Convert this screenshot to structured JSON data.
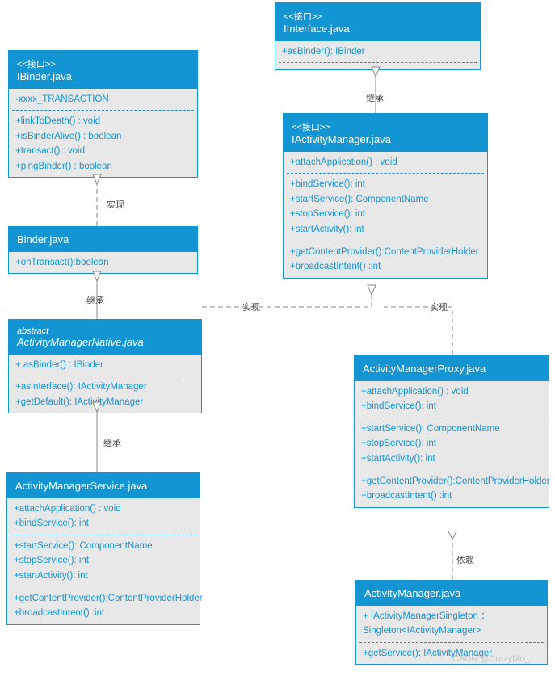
{
  "classes": {
    "ibinder": {
      "stereotype": "<<接口>>",
      "name": "IBinder.java",
      "attrs": "-xxxx_TRANSACTION",
      "methods": "+linkToDeath() : void\n+isBinderAlive() : boolean\n+transact() : void\n+pingBinder() : boolean"
    },
    "iinterface": {
      "stereotype": "<<接口>>",
      "name": "IInterface.java",
      "m1": "+asBinder(): IBinder"
    },
    "binder": {
      "name": "Binder.java",
      "m1": "+onTransact():boolean"
    },
    "iactivitymanager": {
      "stereotype": "<<接口>>",
      "name": "IActivityManager.java",
      "m1": "+attachApplication() : void",
      "m2": "+bindService(): int\n+startService(): ComponentName\n+stopService(): int\n+startActivity(): int",
      "m3": "+getContentProvider():ContentProviderHolder\n+broadcastIntent() :int"
    },
    "amnative": {
      "stereotype": "abstract",
      "name": "ActivityManagerNative.java",
      "m1": "+ asBinder() : IBinder",
      "m2": "+asInterface(): IActivityManager\n+getDefault(): IActivityManager"
    },
    "amproxy": {
      "name": "ActivityManagerProxy.java",
      "m1": "+attachApplication() : void\n+bindService(): int",
      "m2": "+startService(): ComponentName\n+stopService(): int\n+startActivity(): int",
      "m3": "+getContentProvider():ContentProviderHolder\n+broadcastIntent() :int"
    },
    "ams": {
      "name": "ActivityManagerService.java",
      "m1": "+attachApplication() : void\n+bindService(): int",
      "m2": "+startService(): ComponentName\n+stopService(): int\n+startActivity(): int",
      "m3": "+getContentProvider():ContentProviderHolder\n+broadcastIntent() :int"
    },
    "am": {
      "name": "ActivityManager.java",
      "m1": "+ IActivityManagerSingleton ：Singleton<IActivityManager>",
      "m2": "+getService(): IActivityManager"
    }
  },
  "labels": {
    "realize": "实现",
    "inherit": "继承",
    "depend": "依赖"
  },
  "watermark": "CSDN @CrazyMo_"
}
